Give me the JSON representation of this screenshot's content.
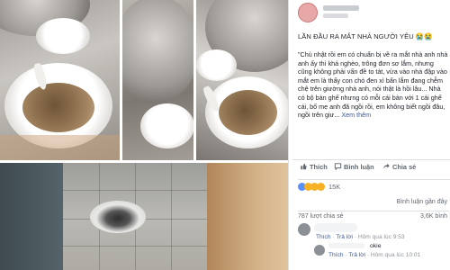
{
  "post": {
    "title": "LẦN ĐẦU RA MẮT NHÀ NGƯỜI YÊU 😭😭",
    "body": "\"Chủ nhật rồi em có chuẩn bị về ra mắt nhà anh nhà anh ấy thì khá nghèo, trông đơn sơ lắm, nhưng cũng không phải vấn đề to tát, vừa vào nhà đập vào mắt em là thấy con chó đen xì bẩn lắm đang chễm chệ trên giường nhà anh, nói thật là hồi lâu... Nhà có bộ bàn ghế nhưng có mỗi cái bàn với 1 cái ghế cái, bố mẹ anh đã ngồi rồi, em không biết ngồi đâu, ngồi trên giư...",
    "see_more": "Xem thêm"
  },
  "actions": {
    "like": "Thích",
    "comment": "Bình luận",
    "share": "Chia sẻ"
  },
  "reactions": {
    "count": "15K"
  },
  "stats": {
    "comments_label": "Bình luận gần đây",
    "comments_count": "787 lượt chia sẻ",
    "shares_count": "3,6K bình"
  },
  "comments": [
    {
      "meta_like": "Thích",
      "meta_reply": "Trả lời",
      "meta_time": "Hôm qua lúc 9:53"
    },
    {
      "text": "okie",
      "meta_like": "Thích",
      "meta_reply": "Trả lời",
      "meta_time": "Hôm qua lúc 10:01"
    }
  ],
  "colors": {
    "fb_blue": "#385898",
    "text": "#1d2129",
    "muted": "#606770",
    "divider": "#dddfe2"
  },
  "icons": [
    "like-icon",
    "comment-icon",
    "share-icon",
    "reaction-like-icon",
    "reaction-haha-icon",
    "reaction-wow-icon",
    "reaction-sad-icon"
  ]
}
